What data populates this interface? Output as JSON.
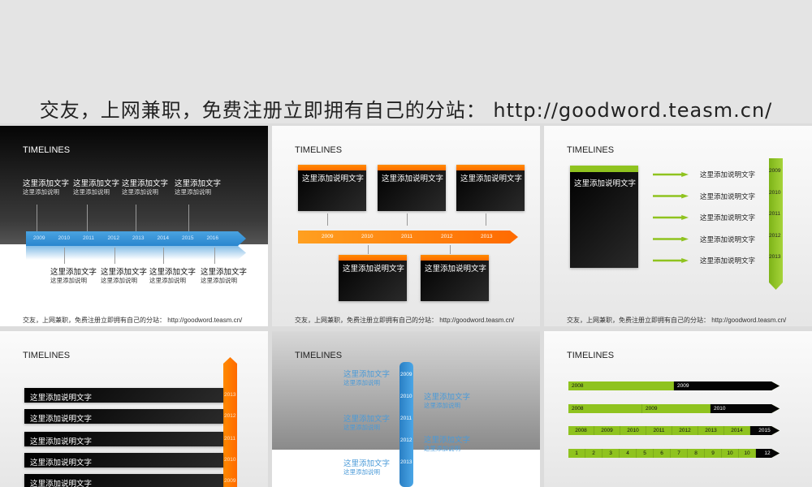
{
  "banner": "交友，上网兼职，免费注册立即拥有自己的分站： http://goodword.teasm.cn/",
  "slide_title": "TIMELINES",
  "footer": "交友，上网兼职，免费注册立即拥有自己的分站： http://goodword.teasm.cn/",
  "label": "这里添加文字",
  "sub": "这里添加说明",
  "desc": "这里添加说明文字",
  "colors": {
    "blue": "#2f8fd6",
    "orange": "#ff7f00",
    "green": "#8fc31f"
  },
  "s1": {
    "years": [
      "2009",
      "2010",
      "2011",
      "2012",
      "2013",
      "2014",
      "2015",
      "2016"
    ]
  },
  "s2": {
    "years": [
      "2009",
      "2010",
      "2011",
      "2012",
      "2013"
    ]
  },
  "s3": {
    "years": [
      "2009",
      "2010",
      "2011",
      "2012",
      "2013"
    ]
  },
  "s4": {
    "years": [
      "2013",
      "2012",
      "2011",
      "2010",
      "2009"
    ]
  },
  "s5": {
    "years": [
      "2009",
      "2010",
      "2011",
      "2012",
      "2013"
    ]
  },
  "s6": {
    "bar1": [
      "2008",
      "2009"
    ],
    "bar2": [
      "2008",
      "2009",
      "2010"
    ],
    "bar3": [
      "2008",
      "2009",
      "2010",
      "2011",
      "2012",
      "2013",
      "2014",
      "2015"
    ],
    "bar4": [
      "1",
      "2",
      "3",
      "4",
      "5",
      "6",
      "7",
      "8",
      "9",
      "10",
      "10",
      "12"
    ]
  }
}
